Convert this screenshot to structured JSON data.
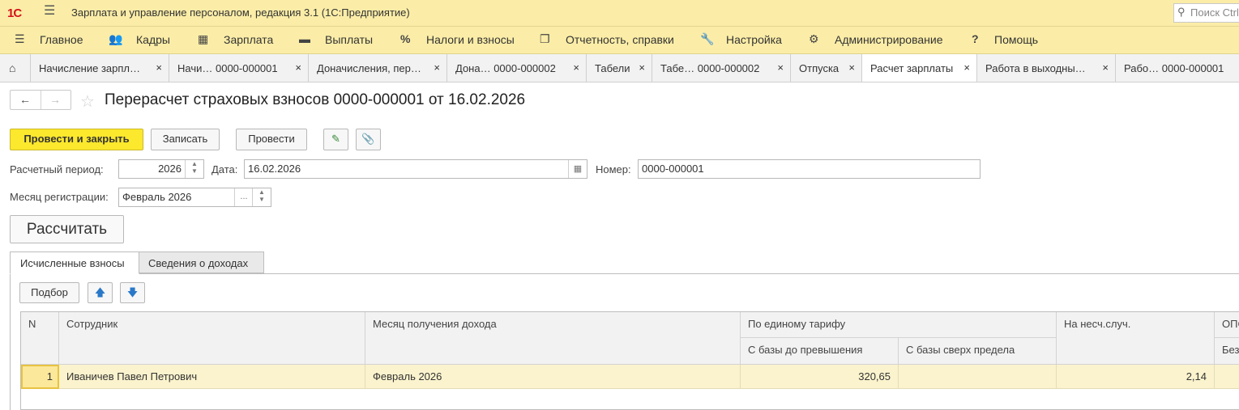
{
  "titlebar": {
    "logo": "1С",
    "app_title": "Зарплата и управление персоналом, редакция 3.1  (1С:Предприятие)",
    "search_placeholder": "Поиск Ctrl+Shift+F"
  },
  "menu": {
    "items": [
      {
        "label": "Главное",
        "icon": "menu-lines-icon"
      },
      {
        "label": "Кадры",
        "icon": "people-icon"
      },
      {
        "label": "Зарплата",
        "icon": "calculator-icon"
      },
      {
        "label": "Выплаты",
        "icon": "card-icon"
      },
      {
        "label": "Налоги и взносы",
        "icon": "percent-icon"
      },
      {
        "label": "Отчетность, справки",
        "icon": "report-icon"
      },
      {
        "label": "Настройка",
        "icon": "wrench-icon"
      },
      {
        "label": "Администрирование",
        "icon": "gear-icon"
      },
      {
        "label": "Помощь",
        "icon": "question-icon"
      }
    ]
  },
  "tabs": [
    {
      "label": "Начисление зарпл…"
    },
    {
      "label": "Начи…   0000-000001"
    },
    {
      "label": "Доначисления, пер…"
    },
    {
      "label": "Дона…   0000-000002"
    },
    {
      "label": "Табели"
    },
    {
      "label": "Табе…   0000-000002"
    },
    {
      "label": "Отпуска"
    },
    {
      "label": "Расчет зарплаты"
    },
    {
      "label": "Работа в выходны…"
    },
    {
      "label": "Рабо…   0000-000001"
    }
  ],
  "document": {
    "title": "Перерасчет страховых взносов 0000-000001 от 16.02.2026",
    "toolbar": {
      "post_close": "Провести и закрыть",
      "save": "Записать",
      "post": "Провести"
    },
    "period_label": "Расчетный период:",
    "period_value": "2026",
    "date_label": "Дата:",
    "date_value": "16.02.2026",
    "number_label": "Номер:",
    "number_value": "0000-000001",
    "reg_month_label": "Месяц регистрации:",
    "reg_month_value": "Февраль 2026",
    "reg_month_dots": "...",
    "calculate": "Рассчитать"
  },
  "form_tabs": [
    {
      "label": "Исчисленные взносы"
    },
    {
      "label": "Сведения о доходах"
    }
  ],
  "table_toolbar": {
    "pick": "Подбор"
  },
  "table": {
    "headers": {
      "n": "N",
      "employee": "Сотрудник",
      "income_month": "Месяц получения дохода",
      "single_tariff": "По единому тарифу",
      "base_below": "С базы до превышения",
      "base_above": "С базы сверх предела",
      "accident": "На несч.случ.",
      "ops_cut": "ОПС",
      "without_cut": "Без"
    },
    "rows": [
      {
        "n": "1",
        "employee": "Иваничев Павел Петрович",
        "income_month": "Февраль 2026",
        "base_below": "320,65",
        "base_above": "",
        "accident": "2,14",
        "extra": ""
      }
    ]
  }
}
